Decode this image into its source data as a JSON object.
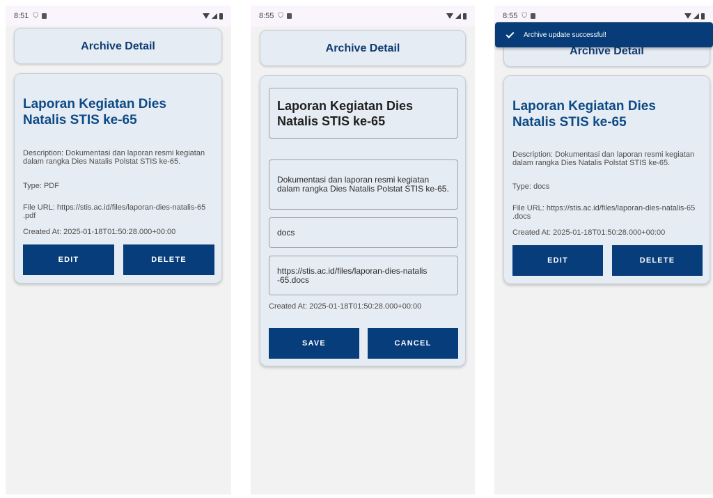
{
  "screen1": {
    "status_time": "8:51",
    "header_title": "Archive Detail",
    "title": "Laporan Kegiatan Dies Natalis STIS ke-65",
    "description": "Description: Dokumentasi dan laporan resmi kegiatan dalam rangka Dies Natalis Polstat STIS ke-65.",
    "type": "Type: PDF",
    "file_url": "File URL: https://stis.ac.id/files/laporan-dies-natalis-65 .pdf",
    "created_at": "Created At: 2025-01-18T01:50:28.000+00:00",
    "edit_label": "EDIT",
    "delete_label": "DELETE"
  },
  "screen2": {
    "status_time": "8:55",
    "header_title": "Archive Detail",
    "title_value": "Laporan Kegiatan Dies Natalis STIS ke-65",
    "description_value": "Dokumentasi dan laporan resmi kegiatan dalam rangka Dies Natalis Polstat STIS ke-65.",
    "type_value": "docs",
    "url_value": "https://stis.ac.id/files/laporan-dies-natalis -65.docs",
    "created_at": "Created At: 2025-01-18T01:50:28.000+00:00",
    "save_label": "SAVE",
    "cancel_label": "CANCEL"
  },
  "screen3": {
    "status_time": "8:55",
    "toast_message": "Archive update successful!",
    "header_title": "Archive Detail",
    "title": "Laporan Kegiatan Dies Natalis STIS ke-65",
    "description": "Description: Dokumentasi dan laporan resmi kegiatan dalam rangka Dies Natalis Polstat STIS ke-65.",
    "type": "Type: docs",
    "file_url": "File URL: https://stis.ac.id/files/laporan-dies-natalis-65 .docs",
    "created_at": "Created At: 2025-01-18T01:50:28.000+00:00",
    "edit_label": "EDIT",
    "delete_label": "DELETE"
  },
  "icons": {
    "status": [
      "shield-icon",
      "sd-card-icon",
      "wifi-icon",
      "signal-icon",
      "battery-icon"
    ],
    "toast": "check-icon"
  },
  "colors": {
    "primary": "#083d7c",
    "title": "#0d4a86",
    "card_bg": "#e6ecf3",
    "screen_bg": "#f2f2f3"
  }
}
